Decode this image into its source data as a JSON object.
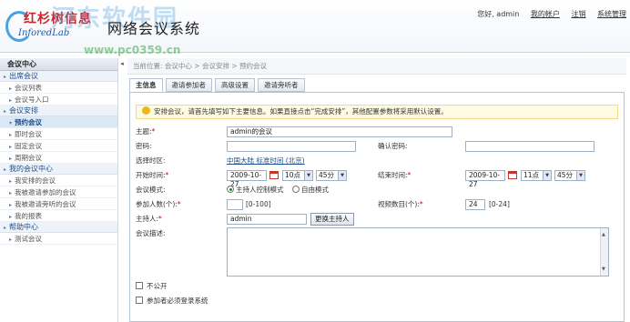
{
  "header": {
    "logo_cn": "红杉树信息",
    "logo_en": "InforedLab",
    "system_title": "网络会议系统",
    "watermark": "河东软件园",
    "watermark_url": "www.pc0359.cn",
    "greeting": "您好, admin",
    "links": [
      "我的帐户",
      "注销",
      "系统管理"
    ]
  },
  "sidebar": {
    "section_title": "会议中心",
    "groups": [
      {
        "label": "出席会议",
        "items": [
          "会议列表",
          "会议号入口"
        ]
      },
      {
        "label": "会议安排",
        "items": []
      },
      {
        "label": "预约会议",
        "items": [
          "即时会议",
          "固定会议",
          "周期会议"
        ],
        "active": true
      },
      {
        "label": "我的会议中心",
        "items": [
          "我安排的会议",
          "我被邀请参加的会议",
          "我被邀请旁听的会议",
          "我的报表"
        ]
      },
      {
        "label": "帮助中心",
        "items": [
          "测试会议"
        ]
      }
    ]
  },
  "breadcrumb": "当前位置: 会议中心 > 会议安排 > 预约会议",
  "tabs": [
    "主信息",
    "邀请参加者",
    "高级设置",
    "邀请旁听者"
  ],
  "notice": "安排会议，请首先填写如下主要信息。如果直接点击“完成安排”，其他配置参数将采用默认设置。",
  "form": {
    "subject_label": "主题:",
    "subject_value": "admin的会议",
    "password_label": "密码:",
    "confirm_password_label": "确认密码:",
    "timezone_label": "选择时区:",
    "timezone_value": "中国大陆 标准时间 (北京)",
    "start_label": "开始时间:",
    "start_date": "2009-10-27",
    "start_hour": "10点",
    "start_min": "45分",
    "end_label": "结束时间:",
    "end_date": "2009-10-27",
    "end_hour": "11点",
    "end_min": "45分",
    "mode_label": "会议模式:",
    "mode_options": [
      "主持人控制模式",
      "自由模式"
    ],
    "attendees_label": "参加人数(个):",
    "attendees_range": "[0-100]",
    "video_label": "视频数目(个):",
    "video_value": "24",
    "video_range": "[0-24]",
    "host_label": "主持人:",
    "host_value": "admin",
    "change_host_button": "更换主持人",
    "desc_label": "会议描述:",
    "not_public_label": "不公开",
    "must_login_label": "参加者必须登录系统"
  }
}
